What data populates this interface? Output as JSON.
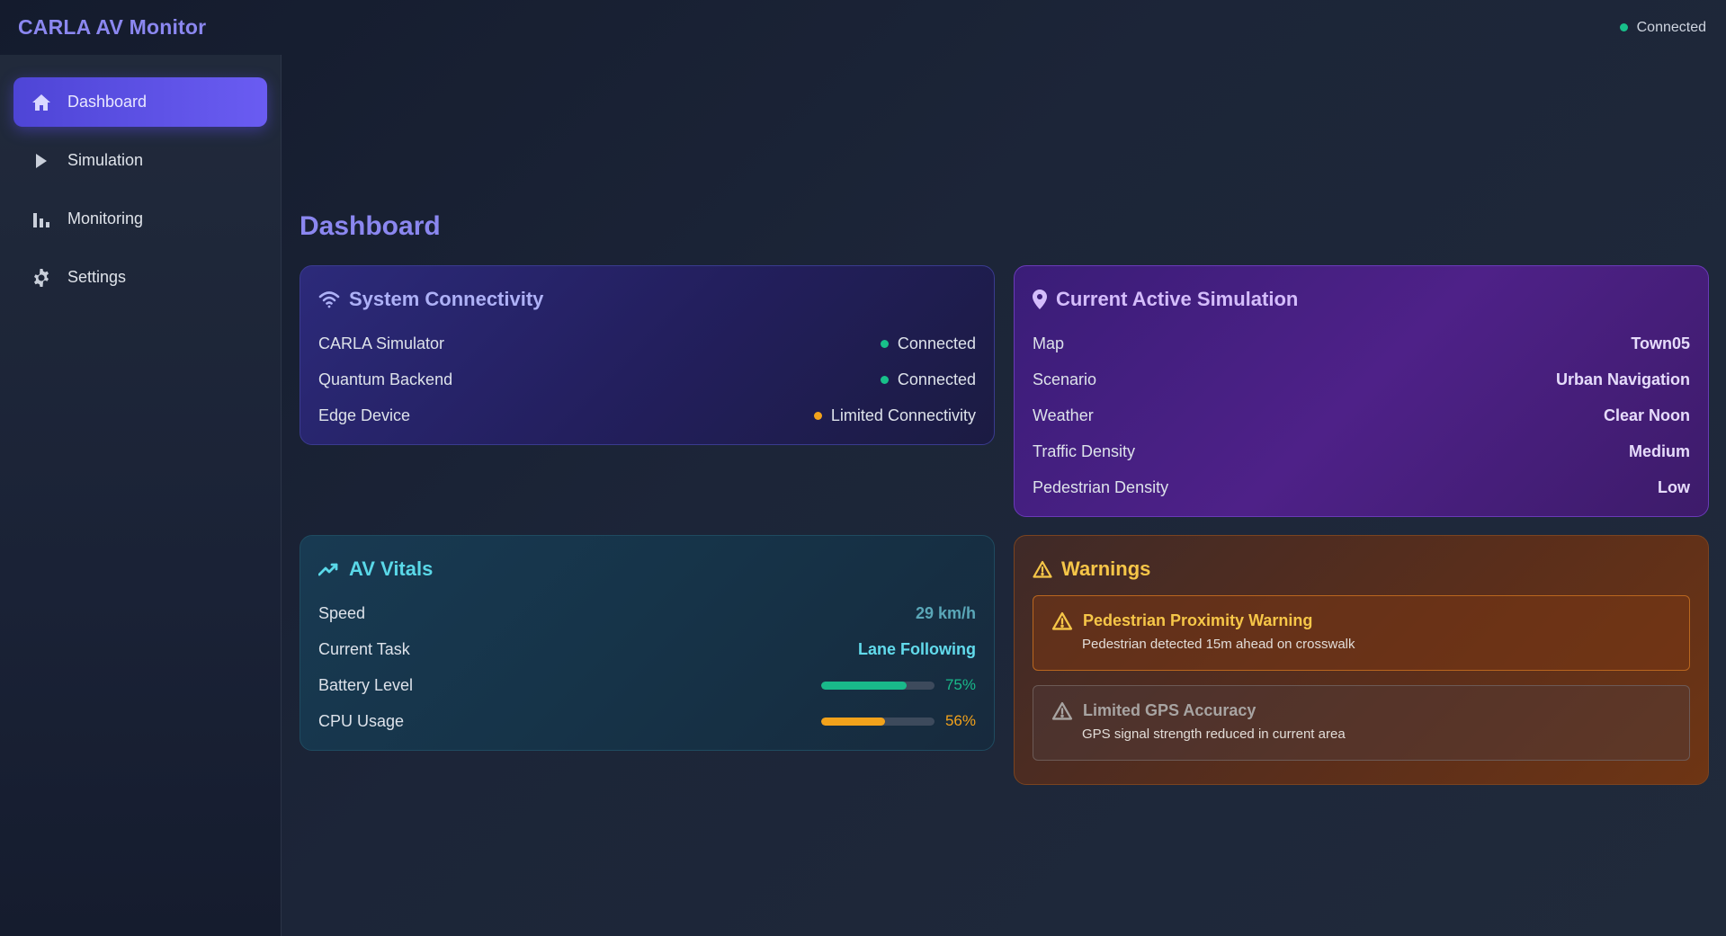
{
  "app": {
    "title": "CARLA AV Monitor",
    "status": "Connected"
  },
  "sidebar": {
    "items": [
      {
        "label": "Dashboard",
        "icon": "home-icon",
        "active": true
      },
      {
        "label": "Simulation",
        "icon": "play-icon",
        "active": false
      },
      {
        "label": "Monitoring",
        "icon": "bar-chart-icon",
        "active": false
      },
      {
        "label": "Settings",
        "icon": "gear-icon",
        "active": false
      }
    ]
  },
  "page": {
    "title": "Dashboard"
  },
  "connectivity": {
    "title": "System Connectivity",
    "icon": "wifi-icon",
    "rows": [
      {
        "label": "CARLA Simulator",
        "value": "Connected",
        "status": "green"
      },
      {
        "label": "Quantum Backend",
        "value": "Connected",
        "status": "green"
      },
      {
        "label": "Edge Device",
        "value": "Limited Connectivity",
        "status": "orange"
      }
    ]
  },
  "simulation": {
    "title": "Current Active Simulation",
    "icon": "map-pin-icon",
    "rows": [
      {
        "label": "Map",
        "value": "Town05"
      },
      {
        "label": "Scenario",
        "value": "Urban Navigation"
      },
      {
        "label": "Weather",
        "value": "Clear Noon"
      },
      {
        "label": "Traffic Density",
        "value": "Medium"
      },
      {
        "label": "Pedestrian Density",
        "value": "Low"
      }
    ]
  },
  "vitals": {
    "title": "AV Vitals",
    "icon": "trend-line-icon",
    "speed": {
      "label": "Speed",
      "value": "29 km/h"
    },
    "task": {
      "label": "Current Task",
      "value": "Lane Following"
    },
    "battery": {
      "label": "Battery Level",
      "value": "75%",
      "level": 0.75,
      "color": "#19b98a"
    },
    "cpu": {
      "label": "CPU Usage",
      "value": "56%",
      "level": 0.56,
      "color": "#f2a21b"
    }
  },
  "warnings": {
    "title": "Warnings",
    "icon": "warning-triangle-icon",
    "items": [
      {
        "title": "Pedestrian Proximity Warning",
        "message": "Pedestrian detected 15m ahead on crosswalk"
      },
      {
        "title": "Limited GPS Accuracy",
        "message": "GPS signal strength reduced in current area"
      }
    ]
  },
  "colors": {
    "accent": "#8b87f0",
    "green": "#18c08a",
    "orange": "#f2a21b"
  }
}
